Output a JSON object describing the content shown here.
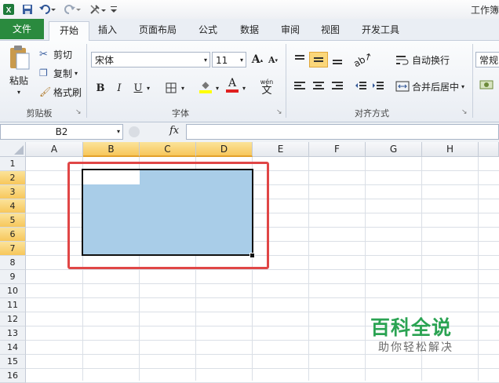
{
  "window": {
    "title": "工作簿"
  },
  "quick_access": [
    "excel-logo-icon",
    "save-icon",
    "undo-icon",
    "redo-icon",
    "customize-icon"
  ],
  "tabs": [
    "文件",
    "开始",
    "插入",
    "页面布局",
    "公式",
    "数据",
    "审阅",
    "视图",
    "开发工具"
  ],
  "active_tab": "开始",
  "ribbon": {
    "clipboard": {
      "paste": "粘贴",
      "cut": "剪切",
      "copy": "复制",
      "format_painter": "格式刷",
      "group": "剪贴板"
    },
    "font": {
      "name": "宋体",
      "size": "11",
      "bold": "B",
      "italic": "I",
      "underline": "U",
      "phonetic": "wén",
      "phonetic_char": "文",
      "grow": "A",
      "shrink": "A",
      "group": "字体"
    },
    "alignment": {
      "wrap": "自动换行",
      "merge": "合并后居中",
      "group": "对齐方式"
    },
    "number": {
      "format": "常规"
    }
  },
  "formula_bar": {
    "cell_ref": "B2",
    "fx": "fx",
    "value": ""
  },
  "sheet": {
    "columns": [
      "A",
      "B",
      "C",
      "D",
      "E",
      "F",
      "G",
      "H"
    ],
    "rows": [
      "1",
      "2",
      "3",
      "4",
      "5",
      "6",
      "7",
      "8",
      "9",
      "10",
      "11",
      "12",
      "13",
      "14",
      "15",
      "16"
    ],
    "selected_range": "B2:D7",
    "active_cell": "B2"
  },
  "watermark": {
    "title": "百科全说",
    "subtitle": "助你轻松解决"
  },
  "colors": {
    "file_tab": "#2a8a3e",
    "selection": "#a9cde8",
    "highlight_box": "#e04646",
    "header_selected": "#f7c75b",
    "watermark_green": "#2aa352"
  }
}
